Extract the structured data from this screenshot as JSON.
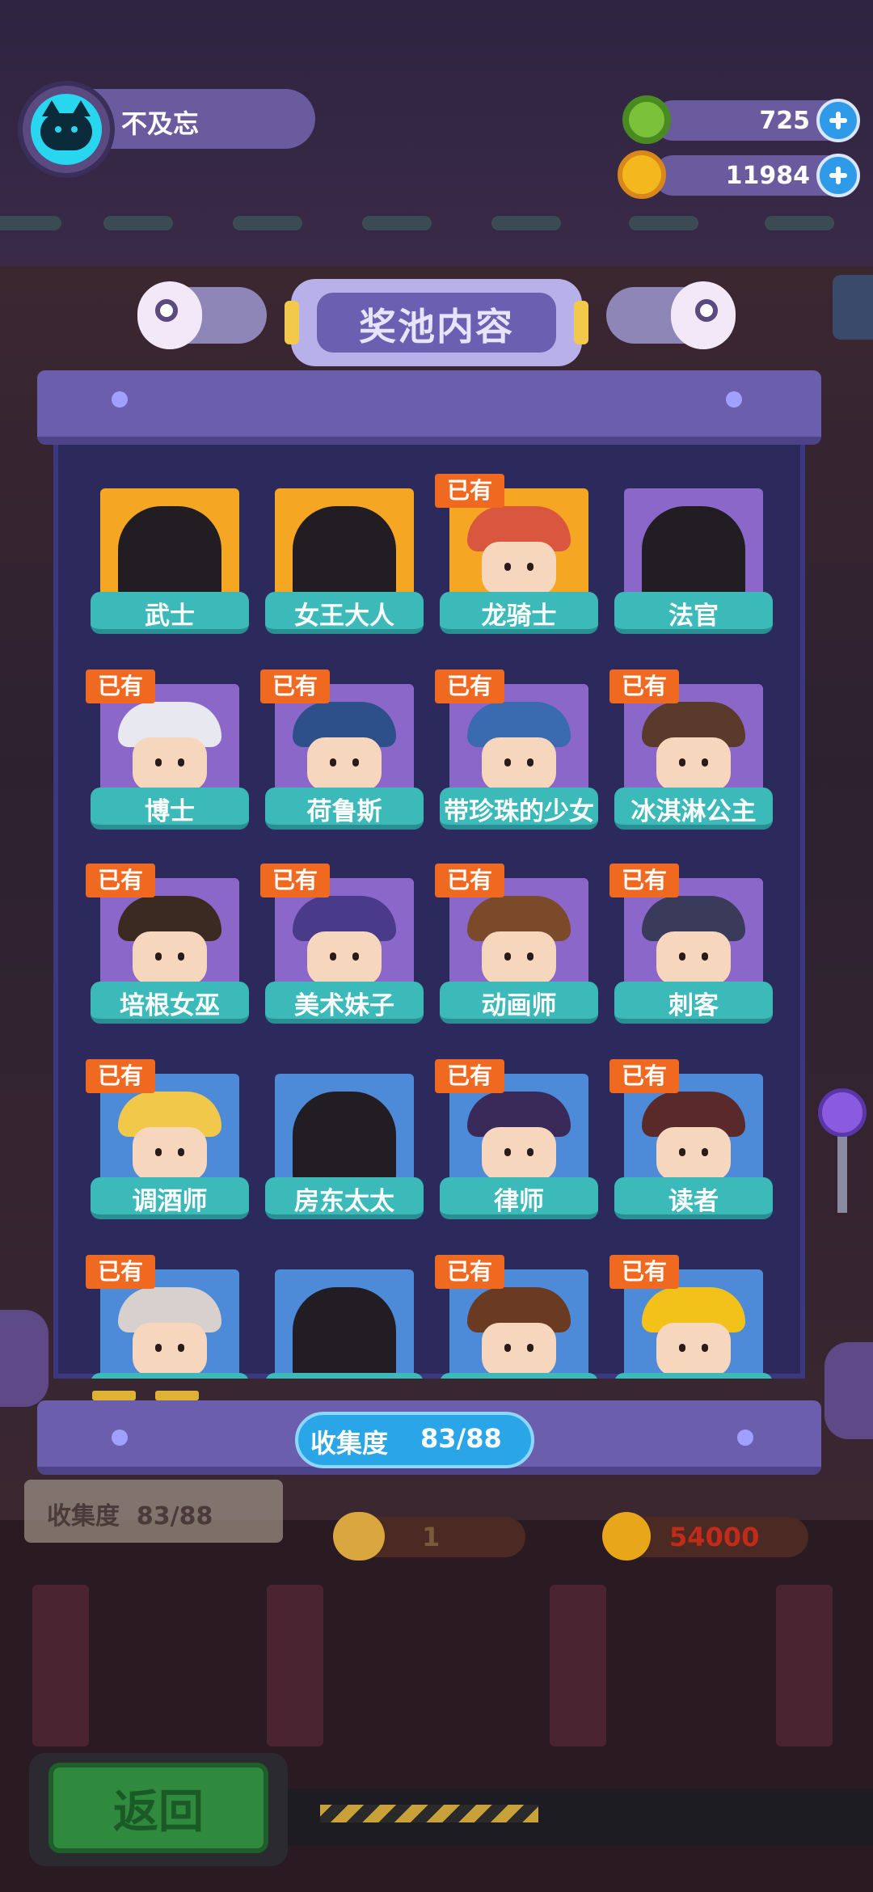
{
  "player": {
    "name": "不及忘",
    "avatar_icon": "cat-avatar-icon"
  },
  "currency": [
    {
      "icon": "green-gem-coin-icon",
      "value": "725"
    },
    {
      "icon": "gold-planet-coin-icon",
      "value": "11984"
    }
  ],
  "panel": {
    "title": "奖池内容",
    "owned_label": "已有",
    "collection_label": "收集度",
    "collection_value": "83/88"
  },
  "characters": [
    {
      "name": "武士",
      "owned": false,
      "bg": "gold"
    },
    {
      "name": "女王大人",
      "owned": false,
      "bg": "gold"
    },
    {
      "name": "龙骑士",
      "owned": true,
      "bg": "gold",
      "hair": "#d9573f"
    },
    {
      "name": "法官",
      "owned": false,
      "bg": "purple"
    },
    {
      "name": "博士",
      "owned": true,
      "bg": "purple",
      "hair": "#e8e8f0"
    },
    {
      "name": "荷鲁斯",
      "owned": true,
      "bg": "purple",
      "hair": "#2d4f8a"
    },
    {
      "name": "带珍珠的少女",
      "owned": true,
      "bg": "purple",
      "hair": "#3a6ab0"
    },
    {
      "name": "冰淇淋公主",
      "owned": true,
      "bg": "purple",
      "hair": "#5a3a2a"
    },
    {
      "name": "培根女巫",
      "owned": true,
      "bg": "purple",
      "hair": "#3a2a22"
    },
    {
      "name": "美术妹子",
      "owned": true,
      "bg": "purple",
      "hair": "#4a3a8a"
    },
    {
      "name": "动画师",
      "owned": true,
      "bg": "purple",
      "hair": "#7a4a2a"
    },
    {
      "name": "刺客",
      "owned": true,
      "bg": "purple",
      "hair": "#3a3a5a"
    },
    {
      "name": "调酒师",
      "owned": true,
      "bg": "blue",
      "hair": "#f2c84a"
    },
    {
      "name": "房东太太",
      "owned": false,
      "bg": "blue"
    },
    {
      "name": "律师",
      "owned": true,
      "bg": "blue",
      "hair": "#3a2a5a"
    },
    {
      "name": "读者",
      "owned": true,
      "bg": "blue",
      "hair": "#5a2a2a"
    },
    {
      "name": "",
      "owned": true,
      "bg": "blue",
      "hair": "#d8d0cc"
    },
    {
      "name": "",
      "owned": false,
      "bg": "blue"
    },
    {
      "name": "",
      "owned": true,
      "bg": "blue",
      "hair": "#6a3a22"
    },
    {
      "name": "",
      "owned": true,
      "bg": "blue",
      "hair": "#f2c21a"
    }
  ],
  "background": {
    "collection_label": "收集度",
    "collection_value": "83/88",
    "ticket_count": "1",
    "price": "54000"
  },
  "return_button": "返回",
  "colors": {
    "accent_blue": "#2aa6e8",
    "owned_badge": "#ef6a20",
    "name_ribbon": "#3cb9b9",
    "return_green": "#2f8a3d"
  }
}
